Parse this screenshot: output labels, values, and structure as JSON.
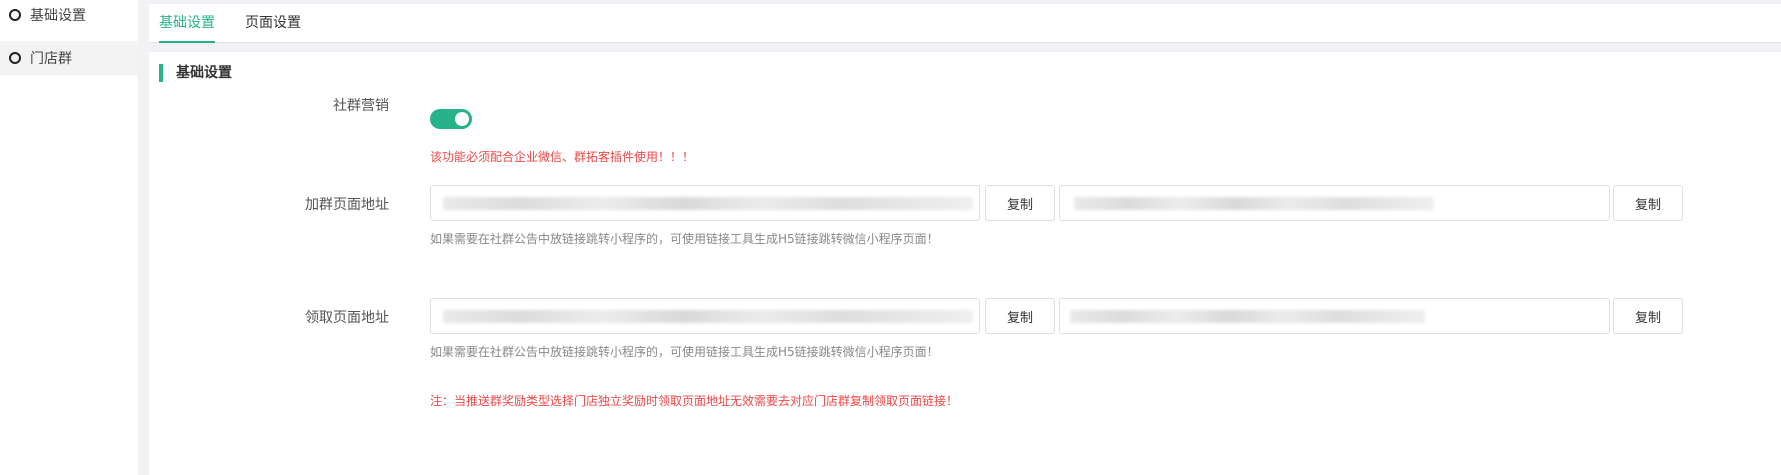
{
  "sidebar": {
    "items": [
      {
        "label": "基础设置"
      },
      {
        "label": "门店群"
      }
    ]
  },
  "tabs": [
    {
      "label": "基础设置",
      "active": true
    },
    {
      "label": "页面设置",
      "active": false
    }
  ],
  "section": {
    "title": "基础设置"
  },
  "community_marketing": {
    "label": "社群营销",
    "enabled": true,
    "warning": "该功能必须配合企业微信、群拓客插件使用！！！"
  },
  "join_page": {
    "label": "加群页面地址",
    "url1": "",
    "url2": "",
    "copy1_label": "复制",
    "copy2_label": "复制",
    "hint": "如果需要在社群公告中放链接跳转小程序的，可使用链接工具生成H5链接跳转微信小程序页面！"
  },
  "claim_page": {
    "label": "领取页面地址",
    "url1": "",
    "url2": "",
    "copy1_label": "复制",
    "copy2_label": "复制",
    "hint": "如果需要在社群公告中放链接跳转小程序的，可使用链接工具生成H5链接跳转微信小程序页面！",
    "note": "注：当推送群奖励类型选择门店独立奖励时领取页面地址无效需要去对应门店群复制领取页面链接！"
  },
  "colors": {
    "accent": "#27b38a",
    "warning": "#f04848",
    "hint": "#888888"
  }
}
